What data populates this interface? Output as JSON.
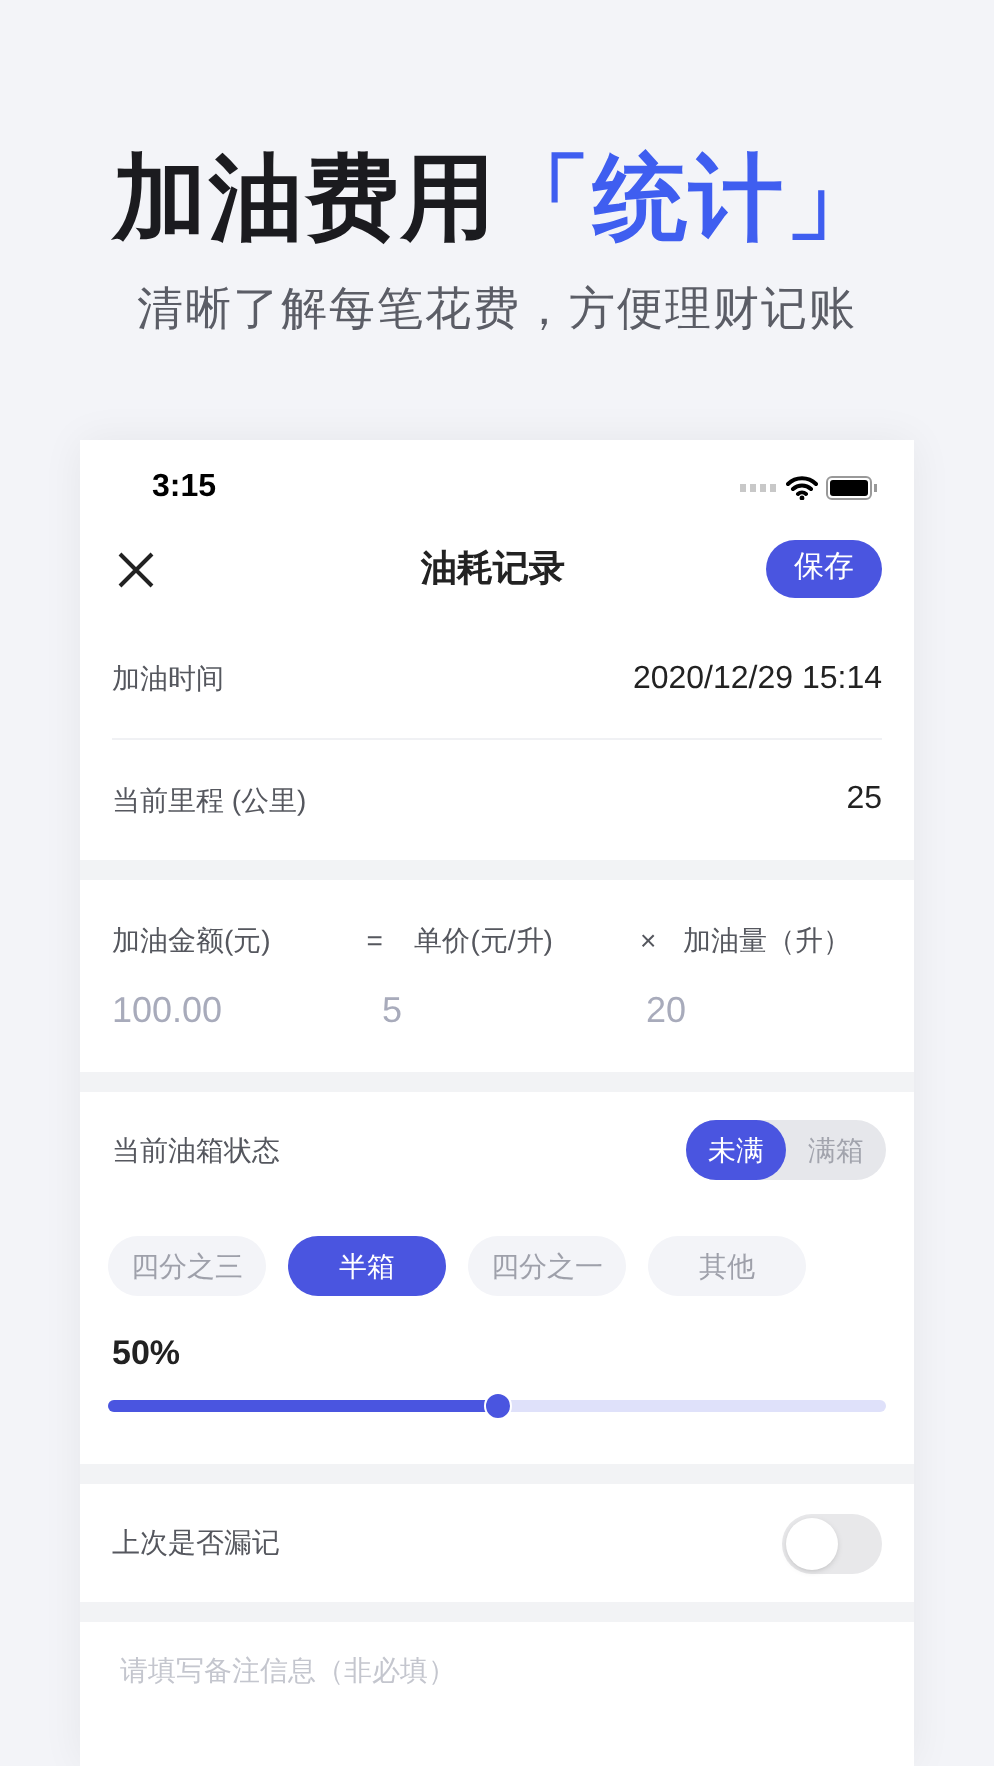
{
  "headline": {
    "text": "加油费用",
    "highlight": "「统计」"
  },
  "subtitle": "清晰了解每笔花费，方便理财记账",
  "status_bar": {
    "time": "3:15"
  },
  "nav": {
    "title": "油耗记录",
    "save": "保存"
  },
  "fields": [
    {
      "label": "加油时间",
      "value": "2020/12/29 15:14"
    },
    {
      "label": "当前里程 (公里)",
      "value": "25"
    }
  ],
  "formula": {
    "labels": [
      "加油金额(元)",
      "=",
      "单价(元/升)",
      "×",
      "加油量（升）"
    ],
    "values": [
      "100.00",
      "5",
      "20"
    ]
  },
  "tank": {
    "label": "当前油箱状态",
    "segments": [
      {
        "label": "未满",
        "selected": true
      },
      {
        "label": "满箱",
        "selected": false
      }
    ],
    "chips": [
      {
        "label": "四分之三",
        "selected": false
      },
      {
        "label": "半箱",
        "selected": true
      },
      {
        "label": "四分之一",
        "selected": false
      },
      {
        "label": "其他",
        "selected": false
      }
    ],
    "reading": "50%",
    "level": 0.5
  },
  "missed": {
    "label": "上次是否漏记",
    "on": false
  },
  "note": {
    "placeholder": "请填写备注信息（非必填）"
  }
}
